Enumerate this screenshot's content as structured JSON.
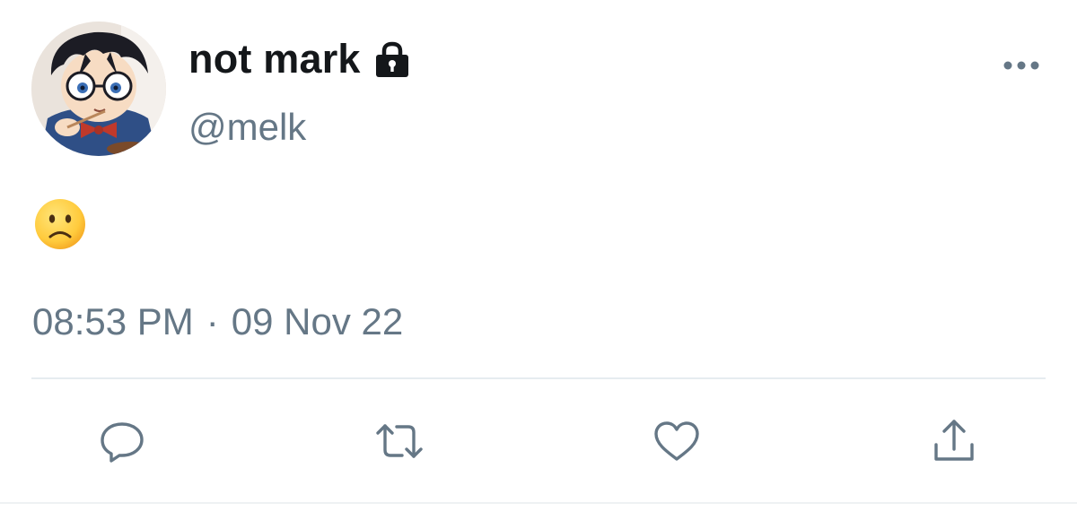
{
  "user": {
    "display_name": "not mark",
    "handle": "@melk",
    "protected": true,
    "avatar": "anime-character-avatar"
  },
  "tweet": {
    "text": "🙁",
    "time": "08:53 PM",
    "separator": "·",
    "date": "09 Nov 22"
  },
  "actions": [
    {
      "name": "reply",
      "icon": "reply-icon"
    },
    {
      "name": "retweet",
      "icon": "retweet-icon"
    },
    {
      "name": "like",
      "icon": "heart-icon"
    },
    {
      "name": "share",
      "icon": "share-icon"
    }
  ],
  "colors": {
    "primary_text": "#14171a",
    "secondary_text": "#657786",
    "divider": "#e6ecf0"
  }
}
